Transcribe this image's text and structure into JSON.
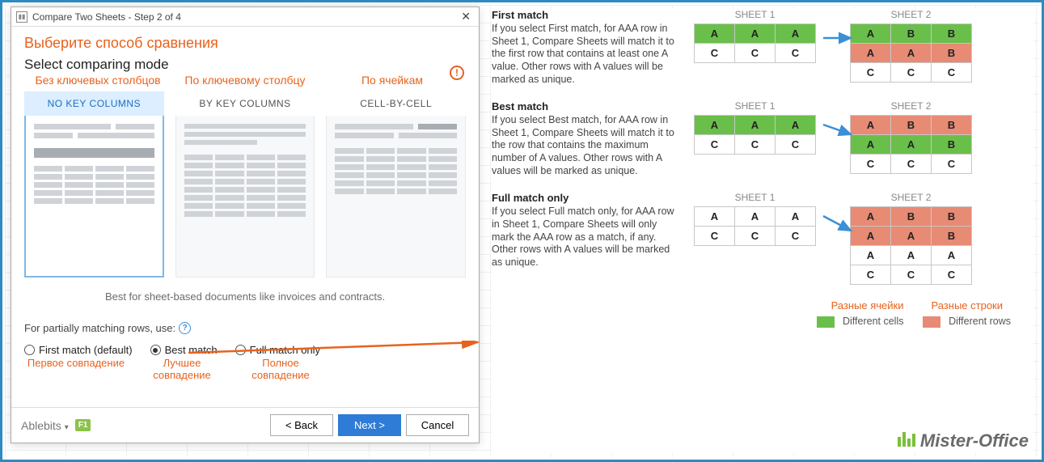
{
  "dialog": {
    "title": "Compare Two Sheets - Step 2 of 4",
    "heading_ru": "Выберите способ сравнения",
    "heading_en": "Select comparing mode",
    "anno": {
      "none": "Без ключевых столбцов",
      "key": "По ключевому столбцу",
      "cell": "По ячейкам"
    },
    "modes": {
      "none": "NO KEY COLUMNS",
      "key": "BY KEY COLUMNS",
      "cell": "CELL-BY-CELL"
    },
    "hint": "Best for sheet-based documents like invoices and contracts.",
    "partial_label": "For partially matching rows, use:",
    "radios": {
      "first": "First match (default)",
      "best": "Best match",
      "full": "Full match only"
    },
    "radio_anno": {
      "first": "Первое совпадение",
      "best": "Лучшее совпадение",
      "full": "Полное совпадение"
    },
    "brand": "Ablebits",
    "f1": "F1",
    "buttons": {
      "back": "< Back",
      "next": "Next >",
      "cancel": "Cancel"
    }
  },
  "examples": {
    "first": {
      "title": "First match",
      "desc": "If you select First match, for AAA row in Sheet 1, Compare Sheets will match it to the first row that contains at least one A value. Other rows with A values will be marked as unique."
    },
    "best": {
      "title": "Best match",
      "desc": "If you select Best match, for AAA row in Sheet 1, Compare Sheets will match it to the row that contains the maximum number of A values. Other rows with A values will be marked as unique."
    },
    "full": {
      "title": "Full match only",
      "desc": "If you select Full match only, for AAA row in Sheet 1, Compare Sheets will only mark the AAA row as a match, if any. Other rows with A values will be marked as unique."
    },
    "sheet1_label": "SHEET 1",
    "sheet2_label": "SHEET 2"
  },
  "legend": {
    "cells_ru": "Разные ячейки",
    "cells_en": "Different cells",
    "rows_ru": "Разные строки",
    "rows_en": "Different rows"
  },
  "watermark": "Mister-Office",
  "chart_data": {
    "type": "table",
    "scenarios": [
      {
        "name": "First match",
        "sheet1": [
          [
            "A",
            "A",
            "A"
          ],
          [
            "C",
            "C",
            "C"
          ]
        ],
        "sheet2": [
          [
            "A",
            "B",
            "B"
          ],
          [
            "A",
            "A",
            "B"
          ],
          [
            "C",
            "C",
            "C"
          ]
        ],
        "sheet1_highlight": [
          [
            "g",
            "g",
            "g"
          ],
          [
            "",
            "",
            ""
          ]
        ],
        "sheet2_highlight": [
          [
            "g",
            "g",
            "g"
          ],
          [
            "r",
            "r",
            "r"
          ],
          [
            "",
            "",
            ""
          ]
        ]
      },
      {
        "name": "Best match",
        "sheet1": [
          [
            "A",
            "A",
            "A"
          ],
          [
            "C",
            "C",
            "C"
          ]
        ],
        "sheet2": [
          [
            "A",
            "B",
            "B"
          ],
          [
            "A",
            "A",
            "B"
          ],
          [
            "C",
            "C",
            "C"
          ]
        ],
        "sheet1_highlight": [
          [
            "g",
            "g",
            "g"
          ],
          [
            "",
            "",
            ""
          ]
        ],
        "sheet2_highlight": [
          [
            "r",
            "r",
            "r"
          ],
          [
            "g",
            "g",
            "g"
          ],
          [
            "",
            "",
            ""
          ]
        ]
      },
      {
        "name": "Full match only",
        "sheet1": [
          [
            "A",
            "A",
            "A"
          ],
          [
            "C",
            "C",
            "C"
          ]
        ],
        "sheet2": [
          [
            "A",
            "B",
            "B"
          ],
          [
            "A",
            "A",
            "B"
          ],
          [
            "A",
            "A",
            "A"
          ],
          [
            "C",
            "C",
            "C"
          ]
        ],
        "sheet1_highlight": [
          [
            "",
            "",
            ""
          ],
          [
            "",
            "",
            ""
          ]
        ],
        "sheet2_highlight": [
          [
            "r",
            "r",
            "r"
          ],
          [
            "r",
            "r",
            "r"
          ],
          [
            "",
            "",
            ""
          ],
          [
            "",
            "",
            ""
          ]
        ]
      }
    ]
  }
}
